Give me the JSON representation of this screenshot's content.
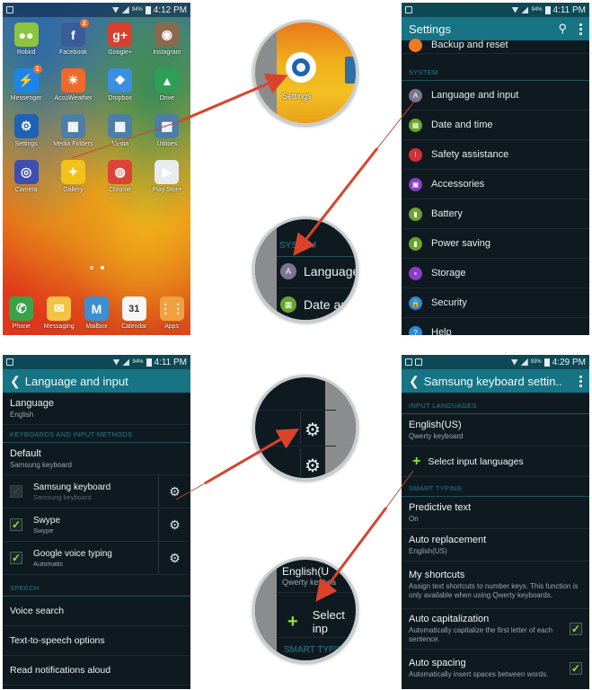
{
  "panels": {
    "home": {
      "status": {
        "battery_pct": "94%",
        "time": "4:12 PM"
      },
      "apps": [
        {
          "label": "Robird",
          "icon": "robird-icon",
          "color": "#8cc43f",
          "glyph": "●●"
        },
        {
          "label": "Facebook",
          "icon": "facebook-icon",
          "color": "#3b5b9a",
          "glyph": "f",
          "badge": "2"
        },
        {
          "label": "Google+",
          "icon": "google-plus-icon",
          "color": "#d6402f",
          "glyph": "g+"
        },
        {
          "label": "Instagram",
          "icon": "instagram-icon",
          "color": "#8a6a4d",
          "glyph": "◉"
        },
        {
          "label": "Messenger",
          "icon": "messenger-icon",
          "color": "#1c86e8",
          "glyph": "⚡",
          "badge": "1"
        },
        {
          "label": "AccuWeather",
          "icon": "accuweather-icon",
          "color": "#f0682a",
          "glyph": "☀"
        },
        {
          "label": "Dropbox",
          "icon": "dropbox-icon",
          "color": "#3a8fe0",
          "glyph": "❖"
        },
        {
          "label": "Drive",
          "icon": "drive-icon",
          "color": "#2d9f57",
          "glyph": "▲"
        },
        {
          "label": "Settings",
          "icon": "settings-icon",
          "color": "#1d62b4",
          "glyph": "⚙"
        },
        {
          "label": "Media Folders",
          "icon": "folder-icon",
          "color": "#4c7ea6",
          "glyph": "▦"
        },
        {
          "label": "Media",
          "icon": "folder-icon",
          "color": "#4c7ea6",
          "glyph": "▦"
        },
        {
          "label": "Utilities",
          "icon": "folder-icon",
          "color": "#4c7ea6",
          "glyph": "▦"
        },
        {
          "label": "Camera",
          "icon": "camera-icon",
          "color": "#3f4fb0",
          "glyph": "◎"
        },
        {
          "label": "Gallery",
          "icon": "gallery-icon",
          "color": "#f2c21a",
          "glyph": "✦"
        },
        {
          "label": "Chrome",
          "icon": "chrome-icon",
          "color": "#db4437",
          "glyph": "◍"
        },
        {
          "label": "Play Store",
          "icon": "play-store-icon",
          "color": "#e8eaed",
          "glyph": "▶"
        }
      ],
      "dock": [
        {
          "label": "Phone",
          "icon": "phone-icon",
          "color": "#3aa34a",
          "glyph": "✆"
        },
        {
          "label": "Messaging",
          "icon": "messaging-icon",
          "color": "#f3c345",
          "glyph": "✉"
        },
        {
          "label": "Mailbox",
          "icon": "mailbox-icon",
          "color": "#3c8fd3",
          "glyph": "M"
        },
        {
          "label": "Calendar",
          "icon": "calendar-icon",
          "color": "#f6f6f6",
          "glyph": "31"
        },
        {
          "label": "Apps",
          "icon": "apps-grid-icon",
          "color": "#f0a040",
          "glyph": "⋮⋮"
        }
      ]
    },
    "settings": {
      "status": {
        "battery_pct": "94%",
        "time": "4:11 PM"
      },
      "title": "Settings",
      "partial_item": {
        "label": "Backup and reset",
        "color": "#f07a22",
        "icon": "backup-icon"
      },
      "section": "SYSTEM",
      "items": [
        {
          "label": "Language and input",
          "color": "#7b7592",
          "icon": "language-icon",
          "glyph": "A"
        },
        {
          "label": "Date and time",
          "color": "#6aa52a",
          "icon": "date-time-icon",
          "glyph": "▦"
        },
        {
          "label": "Safety assistance",
          "color": "#d4303a",
          "icon": "safety-icon",
          "glyph": "!"
        },
        {
          "label": "Accessories",
          "color": "#8c3cc8",
          "icon": "accessories-icon",
          "glyph": "▣"
        },
        {
          "label": "Battery",
          "color": "#6aa52a",
          "icon": "battery-icon",
          "glyph": "▮"
        },
        {
          "label": "Power saving",
          "color": "#6aa52a",
          "icon": "power-saving-icon",
          "glyph": "▮"
        },
        {
          "label": "Storage",
          "color": "#8c3cc8",
          "icon": "storage-icon",
          "glyph": "▪"
        },
        {
          "label": "Security",
          "color": "#2a8bd4",
          "icon": "security-icon",
          "glyph": "🔒"
        },
        {
          "label": "Help",
          "color": "#2a8bd4",
          "icon": "help-icon",
          "glyph": "?"
        }
      ]
    },
    "language_input": {
      "status": {
        "battery_pct": "94%",
        "time": "4:11 PM"
      },
      "title": "Language and input",
      "language": {
        "title": "Language",
        "value": "English"
      },
      "section_keyboards": "KEYBOARDS AND INPUT METHODS",
      "default": {
        "title": "Default",
        "value": "Samsung keyboard"
      },
      "keyboards": [
        {
          "title": "Samsung keyboard",
          "subtitle": "Samsung keyboard",
          "checked": true,
          "disabled": true
        },
        {
          "title": "Swype",
          "subtitle": "Swype",
          "checked": true,
          "disabled": false
        },
        {
          "title": "Google voice typing",
          "subtitle": "Automatic",
          "checked": true,
          "disabled": false
        }
      ],
      "section_speech": "SPEECH",
      "speech_items": [
        "Voice search",
        "Text-to-speech options",
        "Read notifications aloud"
      ]
    },
    "samsung_keyboard": {
      "status": {
        "battery_pct": "93%",
        "time": "4:29 PM"
      },
      "title": "Samsung keyboard settin..",
      "section_input_languages": "INPUT LANGUAGES",
      "language": {
        "title": "English(US)",
        "value": "Qwerty keyboard"
      },
      "select_languages": "Select input languages",
      "section_smart_typing": "SMART TYPING",
      "predictive": {
        "title": "Predictive text",
        "value": "On"
      },
      "auto_replacement": {
        "title": "Auto replacement",
        "value": "English(US)"
      },
      "shortcuts": {
        "title": "My shortcuts",
        "value": "Assign text shortcuts to number keys. This function is only available when using Qwerty keyboards."
      },
      "auto_cap": {
        "title": "Auto capitalization",
        "value": "Automatically capitalize the first letter of each sentence.",
        "checked": true
      },
      "auto_spacing": {
        "title": "Auto spacing",
        "value": "Automatically insert spaces between words.",
        "checked": true
      }
    }
  },
  "zooms": {
    "settings_app_label": "Settings",
    "system_label": "SYSTEM",
    "language_label": "Language",
    "date_label": "Date an",
    "english_label": "English(U",
    "qwerty_label": "Qwerty keyboa",
    "select_label": "Select inp",
    "smart_typing_label": "SMART TYPIN"
  },
  "colors": {
    "appbar": "#167485",
    "section_text": "#2b7c8c",
    "check_green": "#9be038",
    "arrow_red": "#d9432c"
  }
}
